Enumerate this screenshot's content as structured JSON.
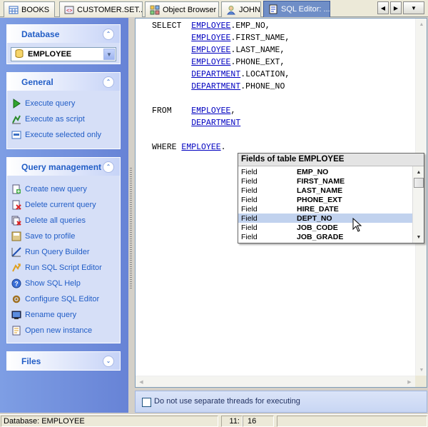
{
  "tabs": [
    {
      "label": "BOOKS",
      "icon": "table-icon",
      "active": false
    },
    {
      "label": "CUSTOMER.SET...",
      "icon": "procedure-icon",
      "active": false
    },
    {
      "label": "Object Browser",
      "icon": "object-browser-icon",
      "active": false
    },
    {
      "label": "JOHN",
      "icon": "user-icon",
      "active": false
    },
    {
      "label": "SQL Editor: ...",
      "icon": "sql-editor-icon",
      "active": true
    }
  ],
  "tab_nav": {
    "left": "◀",
    "right": "▶",
    "menu": "▼"
  },
  "sidebar": {
    "database_panel": {
      "title": "Database",
      "collapse_glyph": "⌃",
      "selected_db": "EMPLOYEE"
    },
    "general_panel": {
      "title": "General",
      "collapse_glyph": "⌃",
      "items": [
        {
          "label": "Execute query",
          "icon": "play-icon"
        },
        {
          "label": "Execute as script",
          "icon": "script-icon"
        },
        {
          "label": "Execute selected only",
          "icon": "selection-icon"
        }
      ]
    },
    "query_panel": {
      "title": "Query management",
      "collapse_glyph": "⌃",
      "items": [
        {
          "label": "Create new query",
          "icon": "new-query-icon"
        },
        {
          "label": "Delete current query",
          "icon": "delete-query-icon"
        },
        {
          "label": "Delete all queries",
          "icon": "delete-all-icon"
        },
        {
          "label": "Save to profile",
          "icon": "save-icon"
        },
        {
          "label": "Run Query Builder",
          "icon": "query-builder-icon"
        },
        {
          "label": "Run SQL Script Editor",
          "icon": "script-editor-icon"
        },
        {
          "label": "Show SQL Help",
          "icon": "help-icon"
        },
        {
          "label": "Configure SQL Editor",
          "icon": "configure-icon"
        },
        {
          "label": "Rename query",
          "icon": "rename-icon"
        },
        {
          "label": "Open new instance",
          "icon": "new-instance-icon"
        }
      ]
    },
    "files_panel": {
      "title": "Files",
      "collapse_glyph": "⌄"
    }
  },
  "editor": {
    "lines": [
      [
        {
          "t": "SELECT  "
        },
        {
          "t": "EMPLOYEE",
          "link": true
        },
        {
          "t": ".EMP_NO,"
        }
      ],
      [
        {
          "t": "        "
        },
        {
          "t": "EMPLOYEE",
          "link": true
        },
        {
          "t": ".FIRST_NAME,"
        }
      ],
      [
        {
          "t": "        "
        },
        {
          "t": "EMPLOYEE",
          "link": true
        },
        {
          "t": ".LAST_NAME,"
        }
      ],
      [
        {
          "t": "        "
        },
        {
          "t": "EMPLOYEE",
          "link": true
        },
        {
          "t": ".PHONE_EXT,"
        }
      ],
      [
        {
          "t": "        "
        },
        {
          "t": "DEPARTMENT",
          "link": true
        },
        {
          "t": ".LOCATION,"
        }
      ],
      [
        {
          "t": "        "
        },
        {
          "t": "DEPARTMENT",
          "link": true
        },
        {
          "t": ".PHONE_NO"
        }
      ],
      [
        {
          "t": ""
        }
      ],
      [
        {
          "t": "FROM    "
        },
        {
          "t": "EMPLOYEE",
          "link": true
        },
        {
          "t": ","
        }
      ],
      [
        {
          "t": "        "
        },
        {
          "t": "DEPARTMENT",
          "link": true
        }
      ],
      [
        {
          "t": ""
        }
      ],
      [
        {
          "t": "WHERE "
        },
        {
          "t": "EMPLOYEE",
          "link": true
        },
        {
          "t": "."
        }
      ]
    ]
  },
  "autocomplete": {
    "title": "Fields of table EMPLOYEE",
    "kind_label": "Field",
    "fields": [
      "EMP_NO",
      "FIRST_NAME",
      "LAST_NAME",
      "PHONE_EXT",
      "HIRE_DATE",
      "DEPT_NO",
      "JOB_CODE",
      "JOB_GRADE"
    ],
    "selected_index": 5
  },
  "options": {
    "thread_checkbox_label": "Do not use separate threads for executing",
    "thread_checkbox_checked": false
  },
  "statusbar": {
    "database": "Database: EMPLOYEE",
    "line": "11:",
    "col": "16"
  }
}
